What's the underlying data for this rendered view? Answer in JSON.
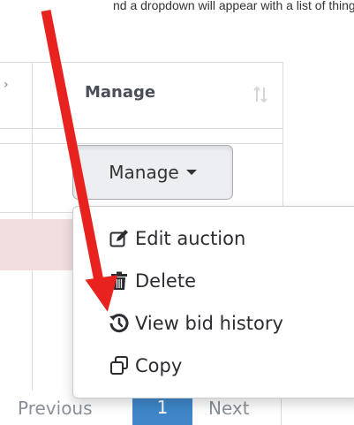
{
  "caption_text": "nd a dropdown will appear with a list of things to do on the given bid. Click",
  "table": {
    "header": {
      "label": "Manage"
    }
  },
  "manage_button": {
    "label": "Manage"
  },
  "dropdown": {
    "items": [
      {
        "label": "Edit auction",
        "icon": "edit-icon"
      },
      {
        "label": "Delete",
        "icon": "trash-icon"
      },
      {
        "label": "View bid history",
        "icon": "history-icon"
      },
      {
        "label": "Copy",
        "icon": "copy-icon"
      }
    ]
  },
  "pagination": {
    "previous_label": "Previous",
    "current_page": "1",
    "next_label": "Next"
  },
  "colors": {
    "arrow": "#e8231f",
    "active_page": "#3f87c9",
    "highlight_row": "#f2dede"
  }
}
